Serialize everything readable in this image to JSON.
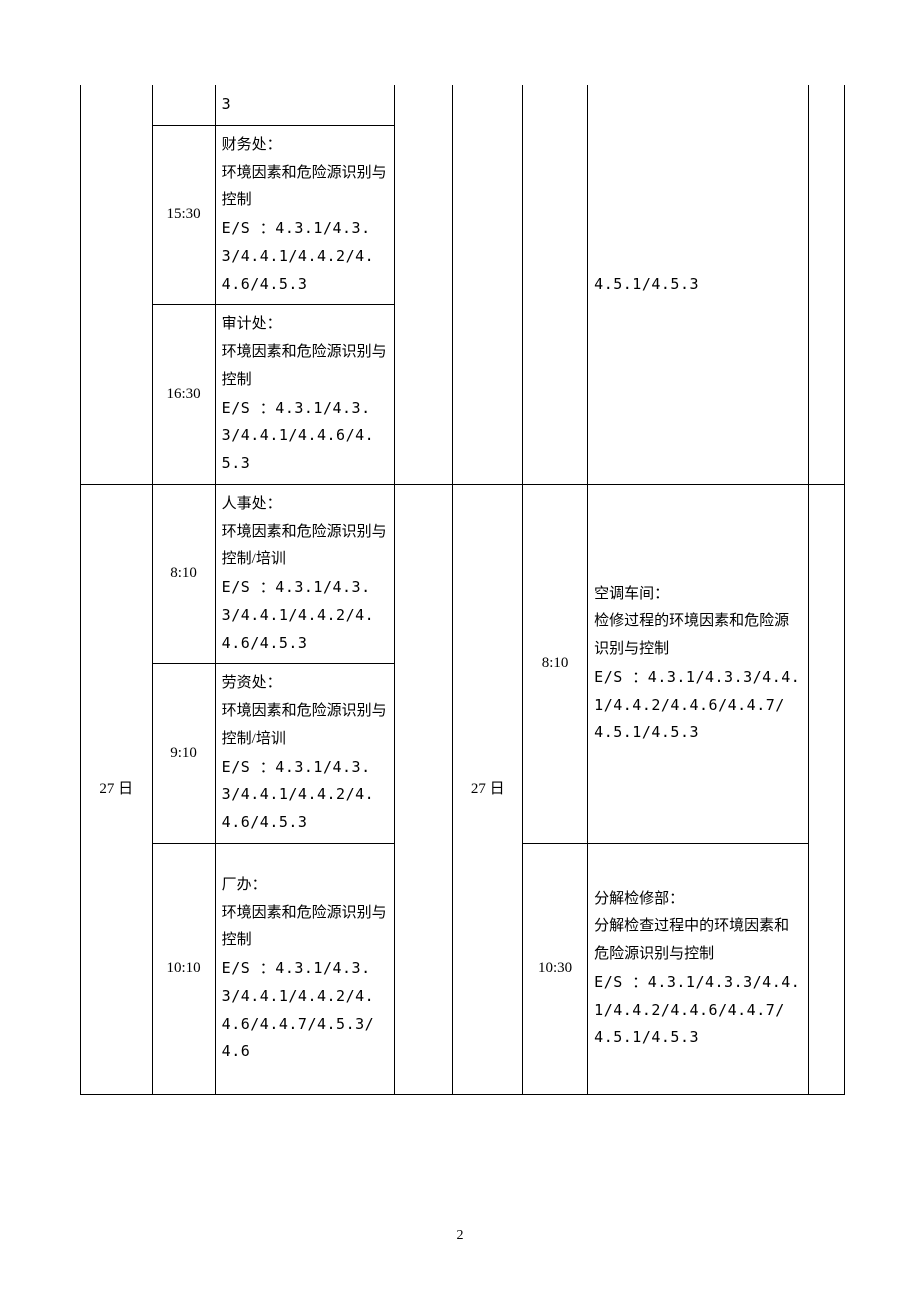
{
  "left": {
    "day_prev": "",
    "row0": {
      "time": "",
      "desc_tail": "3"
    },
    "row1": {
      "time": "15:30",
      "title": "财务处：",
      "sub": "环境因素和危险源识别与控制",
      "ref": "E/S ：4.3.1/4.3.3/4.4.1/4.4.2/4.4.6/4.5.3"
    },
    "row2": {
      "time": "16:30",
      "title": "审计处：",
      "sub": "环境因素和危险源识别与控制",
      "ref": "E/S ：4.3.1/4.3.3/4.4.1/4.4.6/4.5.3"
    },
    "day27": "27 日",
    "row3": {
      "time": "8:10",
      "title": "人事处：",
      "sub": "环境因素和危险源识别与控制/培训",
      "ref": "E/S ：4.3.1/4.3.3/4.4.1/4.4.2/4.4.6/4.5.3"
    },
    "row4": {
      "time": "9:10",
      "title": "劳资处：",
      "sub": "环境因素和危险源识别与控制/培训",
      "ref": "E/S ：4.3.1/4.3.3/4.4.1/4.4.2/4.4.6/4.5.3"
    },
    "row5": {
      "time": "10:10",
      "title": "厂办：",
      "sub": "环境因素和危险源识别与控制",
      "ref": "E/S ：4.3.1/4.3.3/4.4.1/4.4.2/4.4.6/4.4.7/4.5.3/4.6"
    }
  },
  "right": {
    "row0_ref": "4.5.1/4.5.3",
    "day27": "27 日",
    "row3": {
      "time": "8:10",
      "title": "空调车间：",
      "sub": "检修过程的环境因素和危险源识别与控制",
      "ref": "E/S ：4.3.1/4.3.3/4.4.1/4.4.2/4.4.6/4.4.7/4.5.1/4.5.3"
    },
    "row5": {
      "time": "10:30",
      "title": "分解检修部：",
      "sub": "分解检查过程中的环境因素和危险源识别与控制",
      "ref": "E/S ：4.3.1/4.3.3/4.4.1/4.4.2/4.4.6/4.4.7/4.5.1/4.5.3"
    }
  },
  "page_number": "2"
}
